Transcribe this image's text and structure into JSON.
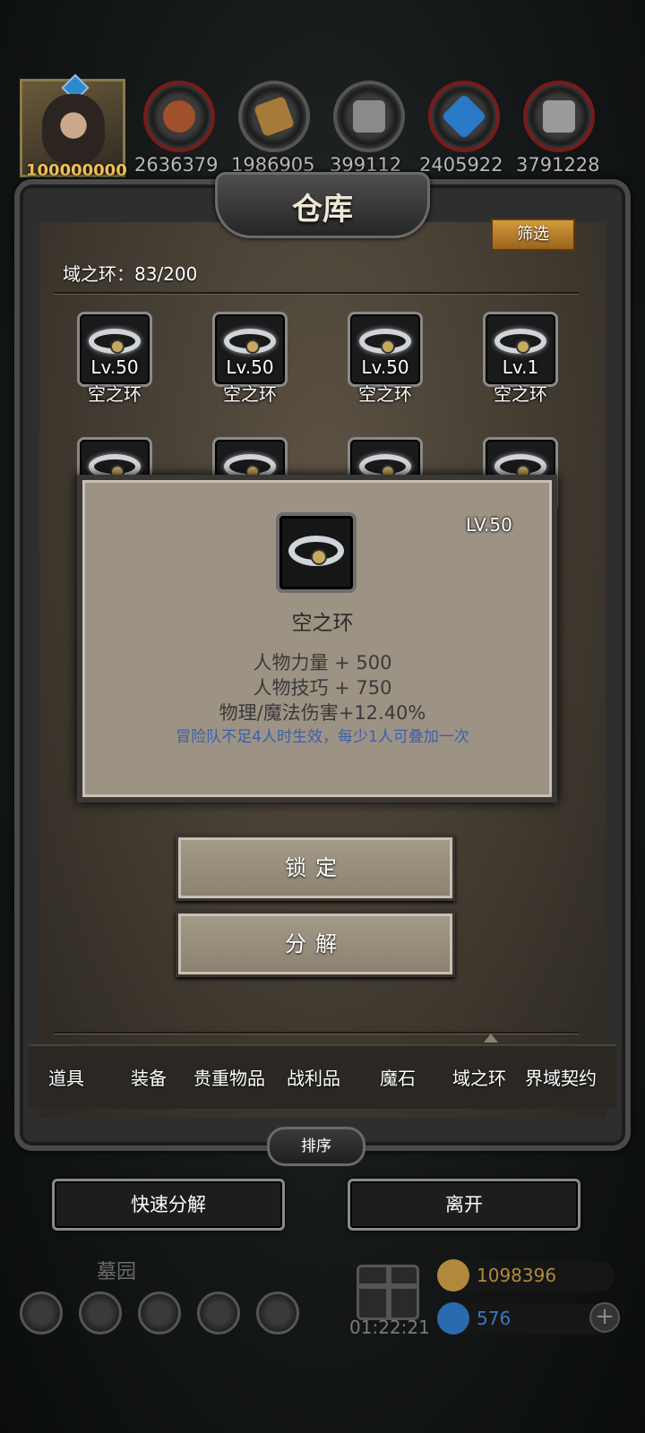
{
  "header": {
    "avatar_value": "100000000",
    "resources": [
      {
        "icon": "red-ore-icon",
        "value": "2636379"
      },
      {
        "icon": "wood-plank-icon",
        "value": "1986905"
      },
      {
        "icon": "iron-ingot-icon",
        "value": "399112"
      },
      {
        "icon": "blue-crystal-icon",
        "value": "2405922"
      },
      {
        "icon": "steel-ingot-icon",
        "value": "3791228"
      }
    ]
  },
  "warehouse": {
    "title": "仓库",
    "filter_label": "筛选",
    "count_label": "域之环：83/200",
    "items": [
      {
        "level": "Lv.50",
        "name": "空之环"
      },
      {
        "level": "Lv.50",
        "name": "空之环"
      },
      {
        "level": "Lv.50",
        "name": "空之环"
      },
      {
        "level": "Lv.1",
        "name": "空之环"
      }
    ]
  },
  "detail_popup": {
    "level": "LV.50",
    "name": "空之环",
    "stats": [
      "人物力量 + 500",
      "人物技巧 + 750",
      "物理/魔法伤害+12.40%"
    ],
    "note": "冒险队不足4人时生效，每少1人可叠加一次",
    "lock_label": "锁定",
    "decompose_label": "分解"
  },
  "tabs": [
    "道具",
    "装备",
    "贵重物品",
    "战利品",
    "魔石",
    "域之环",
    "界域契约"
  ],
  "active_tab": "域之环",
  "sort_label": "排序",
  "quick_decompose_label": "快速分解",
  "leave_label": "离开",
  "bottom": {
    "location": "墓园",
    "timer": "01:22:21",
    "gold": "1098396",
    "gems": "576"
  },
  "colors": {
    "gold_text": "#b08a3a",
    "gem_text": "#3a78c0",
    "note_blue": "#3b5fb0",
    "filter_orange": "#d39a3a"
  }
}
